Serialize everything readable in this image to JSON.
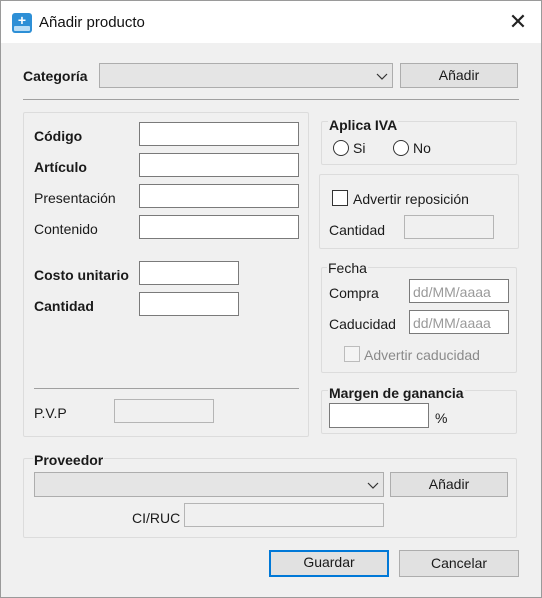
{
  "window": {
    "title": "Añadir producto",
    "close_glyph": "✕",
    "icon": "add-product-icon"
  },
  "categoria": {
    "label": "Categoría",
    "selected": "",
    "add_label": "Añadir"
  },
  "producto": {
    "codigo_label": "Código",
    "codigo_value": "",
    "articulo_label": "Artículo",
    "articulo_value": "",
    "presentacion_label": "Presentación",
    "presentacion_value": "",
    "contenido_label": "Contenido",
    "contenido_value": "",
    "costo_label": "Costo unitario",
    "costo_value": "",
    "cantidad_label": "Cantidad",
    "cantidad_value": "",
    "pvp_label": "P.V.P",
    "pvp_value": ""
  },
  "iva": {
    "title": "Aplica IVA",
    "si_label": "Si",
    "no_label": "No",
    "si_checked": false,
    "no_checked": false
  },
  "reposicion": {
    "check_label": "Advertir reposición",
    "checked": false,
    "cantidad_label": "Cantidad",
    "cantidad_value": ""
  },
  "fecha": {
    "title": "Fecha",
    "compra_label": "Compra",
    "compra_placeholder": "dd/MM/aaaa",
    "caducidad_label": "Caducidad",
    "caducidad_placeholder": "dd/MM/aaaa",
    "advertir_label": "Advertir caducidad"
  },
  "margen": {
    "title": "Margen de ganancia",
    "value": "",
    "unit": "%"
  },
  "proveedor": {
    "title": "Proveedor",
    "selected": "",
    "add_label": "Añadir",
    "ruc_label": "CI/RUC",
    "ruc_value": ""
  },
  "actions": {
    "save_label": "Guardar",
    "cancel_label": "Cancelar"
  },
  "colors": {
    "accent": "#0078d7",
    "window_bg": "#f0f0f0",
    "titlebar_bg": "#ffffff"
  }
}
